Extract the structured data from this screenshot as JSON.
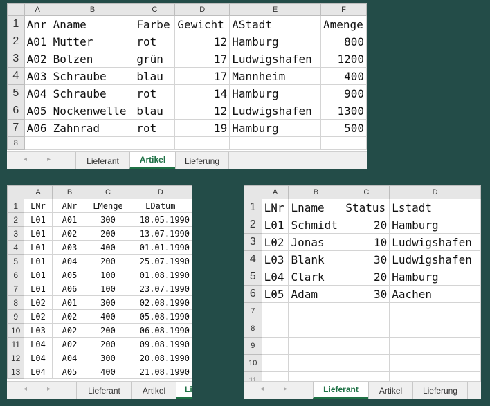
{
  "sheets": {
    "artikel": {
      "columns": [
        "A",
        "B",
        "C",
        "D",
        "E",
        "F"
      ],
      "header": [
        "Anr",
        "Aname",
        "Farbe",
        "Gewicht",
        "AStadt",
        "Amenge"
      ],
      "rows": [
        [
          "A01",
          "Mutter",
          "rot",
          "12",
          "Hamburg",
          "800"
        ],
        [
          "A02",
          "Bolzen",
          "grün",
          "17",
          "Ludwigshafen",
          "1200"
        ],
        [
          "A03",
          "Schraube",
          "blau",
          "17",
          "Mannheim",
          "400"
        ],
        [
          "A04",
          "Schraube",
          "rot",
          "14",
          "Hamburg",
          "900"
        ],
        [
          "A05",
          "Nockenwelle",
          "blau",
          "12",
          "Ludwigshafen",
          "1300"
        ],
        [
          "A06",
          "Zahnrad",
          "rot",
          "19",
          "Hamburg",
          "500"
        ]
      ],
      "row_numbers": [
        "1",
        "2",
        "3",
        "4",
        "5",
        "6",
        "7",
        "8"
      ],
      "tabs": [
        "Lieferant",
        "Artikel",
        "Lieferung"
      ],
      "active_tab": "Artikel"
    },
    "lieferung": {
      "columns": [
        "A",
        "B",
        "C",
        "D"
      ],
      "header": [
        "LNr",
        "ANr",
        "LMenge",
        "LDatum"
      ],
      "rows": [
        [
          "L01",
          "A01",
          "300",
          "18.05.1990"
        ],
        [
          "L01",
          "A02",
          "200",
          "13.07.1990"
        ],
        [
          "L01",
          "A03",
          "400",
          "01.01.1990"
        ],
        [
          "L01",
          "A04",
          "200",
          "25.07.1990"
        ],
        [
          "L01",
          "A05",
          "100",
          "01.08.1990"
        ],
        [
          "L01",
          "A06",
          "100",
          "23.07.1990"
        ],
        [
          "L02",
          "A01",
          "300",
          "02.08.1990"
        ],
        [
          "L02",
          "A02",
          "400",
          "05.08.1990"
        ],
        [
          "L03",
          "A02",
          "200",
          "06.08.1990"
        ],
        [
          "L04",
          "A02",
          "200",
          "09.08.1990"
        ],
        [
          "L04",
          "A04",
          "300",
          "20.08.1990"
        ],
        [
          "L04",
          "A05",
          "400",
          "21.08.1990"
        ]
      ],
      "row_numbers": [
        "1",
        "2",
        "3",
        "4",
        "5",
        "6",
        "7",
        "8",
        "9",
        "10",
        "11",
        "12",
        "13"
      ],
      "tabs": [
        "Lieferant",
        "Artikel",
        "Lieferung"
      ],
      "active_tab": "Lieferung"
    },
    "lieferant": {
      "columns": [
        "A",
        "B",
        "C",
        "D"
      ],
      "header": [
        "LNr",
        "Lname",
        "Status",
        "Lstadt"
      ],
      "rows": [
        [
          "L01",
          "Schmidt",
          "20",
          "Hamburg"
        ],
        [
          "L02",
          "Jonas",
          "10",
          "Ludwigshafen"
        ],
        [
          "L03",
          "Blank",
          "30",
          "Ludwigshafen"
        ],
        [
          "L04",
          "Clark",
          "20",
          "Hamburg"
        ],
        [
          "L05",
          "Adam",
          "30",
          "Aachen"
        ]
      ],
      "row_numbers": [
        "1",
        "2",
        "3",
        "4",
        "5",
        "6",
        "7",
        "8",
        "9",
        "10",
        "11"
      ],
      "tabs": [
        "Lieferant",
        "Artikel",
        "Lieferung"
      ],
      "active_tab": "Lieferant"
    }
  },
  "icons": {
    "nav_prev": "◂",
    "nav_next": "▸"
  },
  "colors": {
    "background": "#234c48",
    "active_tab": "#1e7145"
  }
}
